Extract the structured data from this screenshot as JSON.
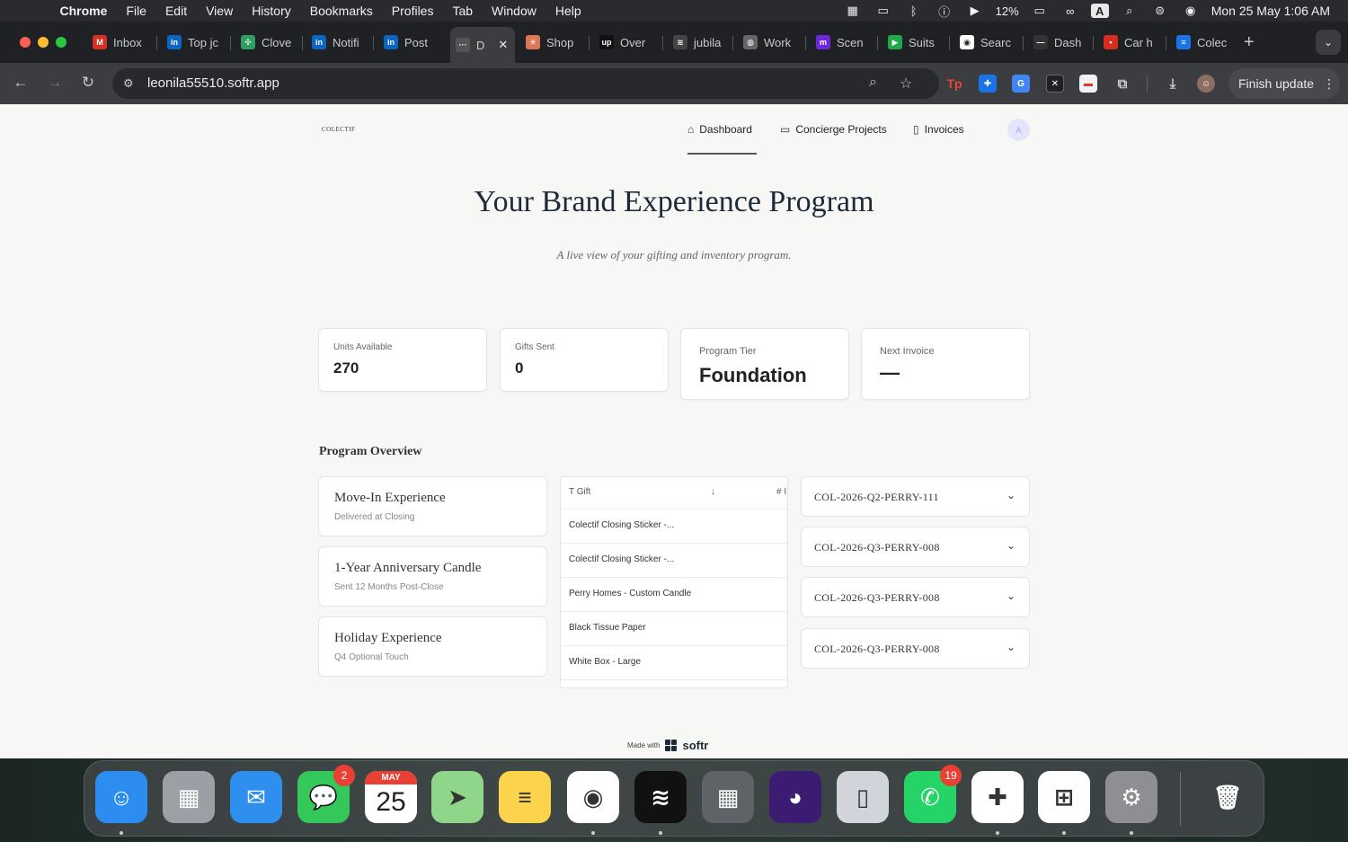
{
  "menubar": {
    "app": "Chrome",
    "items": [
      "File",
      "Edit",
      "View",
      "History",
      "Bookmarks",
      "Profiles",
      "Tab",
      "Window",
      "Help"
    ],
    "battery": "12%",
    "datetime": "Mon 25 May  1:06 AM",
    "input_badge": "A"
  },
  "tabs": [
    {
      "label": "Inbox",
      "icon": "gmail-icon",
      "color": "#d93025",
      "glyph": "M"
    },
    {
      "label": "Top jc",
      "icon": "linkedin-icon",
      "color": "#0a66c2",
      "glyph": "in"
    },
    {
      "label": "Clove",
      "icon": "clover-icon",
      "color": "#2f9e5f",
      "glyph": "✣"
    },
    {
      "label": "Notifi",
      "icon": "linkedin-icon",
      "color": "#0a66c2",
      "glyph": "in"
    },
    {
      "label": "Post",
      "icon": "linkedin-icon",
      "color": "#0a66c2",
      "glyph": "in"
    },
    {
      "label": "D",
      "icon": "dashboard-icon",
      "color": "#555",
      "glyph": "···",
      "active": true
    },
    {
      "label": "Shop",
      "icon": "claude-icon",
      "color": "#d97757",
      "glyph": "✳"
    },
    {
      "label": "Over",
      "icon": "upwork-icon",
      "color": "#111",
      "glyph": "up"
    },
    {
      "label": "jubila",
      "icon": "spotify-icon",
      "color": "#444",
      "glyph": "≋"
    },
    {
      "label": "Work",
      "icon": "globe-icon",
      "color": "#666",
      "glyph": "◍"
    },
    {
      "label": "Scen",
      "icon": "make-icon",
      "color": "#6d28d9",
      "glyph": "m"
    },
    {
      "label": "Suits",
      "icon": "play-icon",
      "color": "#1fa84a",
      "glyph": "▶"
    },
    {
      "label": "Searc",
      "icon": "search-tab-icon",
      "color": "#ffffff",
      "glyph": "◉"
    },
    {
      "label": "Dash",
      "icon": "dash-icon",
      "color": "#333",
      "glyph": "—"
    },
    {
      "label": "Car h",
      "icon": "carhire-icon",
      "color": "#d62d20",
      "glyph": "▪"
    },
    {
      "label": "Colec",
      "icon": "docs-icon",
      "color": "#1a73e8",
      "glyph": "≡"
    }
  ],
  "toolbar": {
    "url": "leonila55510.softr.app",
    "finish_update": "Finish update"
  },
  "site": {
    "logo": "COLECTIF",
    "nav": [
      {
        "label": "Dashboard",
        "icon": "home-icon"
      },
      {
        "label": "Concierge Projects",
        "icon": "folder-icon"
      },
      {
        "label": "Invoices",
        "icon": "file-icon"
      }
    ],
    "avatar": "A",
    "title": "Your Brand Experience Program",
    "subtitle": "A live view of your gifting and inventory program.",
    "stats": [
      {
        "label": "Units Available",
        "value": "270"
      },
      {
        "label": "Gifts Sent",
        "value": "0"
      },
      {
        "label": "Program Tier",
        "value": "Foundation"
      },
      {
        "label": "Next Invoice",
        "value": "—"
      }
    ],
    "section_title": "Program Overview",
    "experiences": [
      {
        "title": "Move-In Experience",
        "subtitle": "Delivered at Closing"
      },
      {
        "title": "1-Year Anniversary Candle",
        "subtitle": "Sent 12 Months Post-Close"
      },
      {
        "title": "Holiday Experience",
        "subtitle": "Q4 Optional Touch"
      }
    ],
    "table": {
      "col1": "Gift",
      "col2": "# I",
      "rows": [
        "Colectif Closing Sticker -...",
        "Colectif Closing Sticker -...",
        "Perry Homes - Custom Candle",
        "Black Tissue Paper",
        "White Box - Large"
      ]
    },
    "accordions": [
      "COL-2026-Q2-PERRY-111",
      "COL-2026-Q3-PERRY-008",
      "COL-2026-Q3-PERRY-008",
      "COL-2026-Q3-PERRY-008"
    ],
    "made_with": "Made with",
    "brand": "softr"
  },
  "dock": {
    "apps": [
      {
        "name": "Finder",
        "icon": "finder-icon",
        "bg": "#2d8cf0",
        "glyph": "☺"
      },
      {
        "name": "Launchpad",
        "icon": "launchpad-icon",
        "bg": "#9aa0a6",
        "glyph": "▦"
      },
      {
        "name": "Mail",
        "icon": "mail-icon",
        "bg": "#2f8fef",
        "glyph": "✉"
      },
      {
        "name": "Messages",
        "icon": "messages-icon",
        "bg": "#34c759",
        "glyph": "💬",
        "badge": "2"
      },
      {
        "name": "Calendar",
        "icon": "calendar-icon",
        "bg": "#ffffff",
        "glyph": "",
        "month": "MAY",
        "day": "25"
      },
      {
        "name": "Maps",
        "icon": "maps-icon",
        "bg": "#8fd68a",
        "glyph": "➤"
      },
      {
        "name": "Notes",
        "icon": "notes-icon",
        "bg": "#fcd34d",
        "glyph": "≡"
      },
      {
        "name": "Chrome",
        "icon": "chrome-icon",
        "bg": "#ffffff",
        "glyph": "◉"
      },
      {
        "name": "Spotify",
        "icon": "spotify-icon",
        "bg": "#111111",
        "glyph": "≋"
      },
      {
        "name": "Calculator",
        "icon": "calculator-icon",
        "bg": "#5f6368",
        "glyph": "▦"
      },
      {
        "name": "Firefox",
        "icon": "firefox-icon",
        "bg": "#3b1c72",
        "glyph": "◕"
      },
      {
        "name": "iPhone Mirroring",
        "icon": "iphone-icon",
        "bg": "#d1d5db",
        "glyph": "▯"
      },
      {
        "name": "WhatsApp",
        "icon": "whatsapp-icon",
        "bg": "#25d366",
        "glyph": "✆",
        "badge": "19"
      },
      {
        "name": "Slack",
        "icon": "slack-icon",
        "bg": "#ffffff",
        "glyph": "✚"
      },
      {
        "name": "Windows App",
        "icon": "windows-icon",
        "bg": "#ffffff",
        "glyph": "⊞"
      },
      {
        "name": "System Settings",
        "icon": "settings-icon",
        "bg": "#8e8e93",
        "glyph": "⚙"
      },
      {
        "name": "Trash",
        "icon": "trash-icon",
        "bg": "transparent",
        "glyph": "🗑"
      }
    ]
  }
}
